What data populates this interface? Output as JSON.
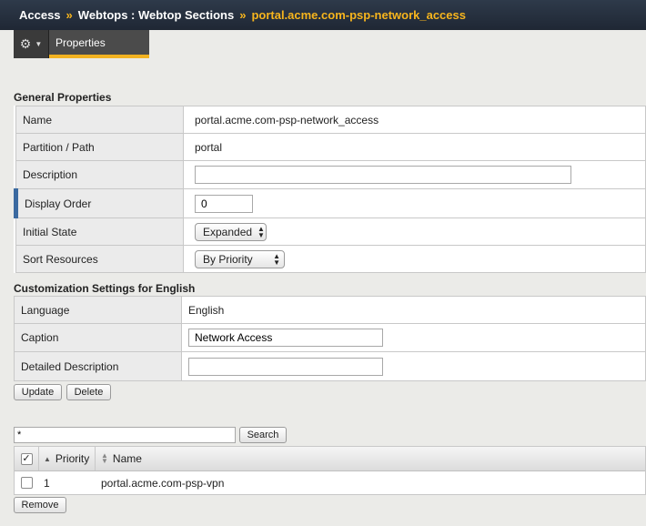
{
  "breadcrumb": {
    "root": "Access",
    "section": "Webtops : Webtop Sections",
    "current": "portal.acme.com-psp-network_access",
    "separator": "»"
  },
  "toolbar": {
    "gear_icon": "gear-icon",
    "tab_properties": "Properties"
  },
  "general": {
    "title": "General Properties",
    "name_label": "Name",
    "name_value": "portal.acme.com-psp-network_access",
    "partition_label": "Partition / Path",
    "partition_value": "portal",
    "description_label": "Description",
    "description_value": "",
    "display_order_label": "Display Order",
    "display_order_value": "0",
    "initial_state_label": "Initial State",
    "initial_state_value": "Expanded",
    "sort_resources_label": "Sort Resources",
    "sort_resources_value": "By Priority"
  },
  "customization": {
    "title": "Customization Settings for English",
    "language_label": "Language",
    "language_value": "English",
    "caption_label": "Caption",
    "caption_value": "Network Access",
    "detailed_label": "Detailed Description",
    "detailed_value": ""
  },
  "actions": {
    "update": "Update",
    "delete": "Delete"
  },
  "resources": {
    "filter_value": "*",
    "search": "Search",
    "header_priority": "Priority",
    "header_name": "Name",
    "rows": [
      {
        "priority": "1",
        "name": "portal.acme.com-psp-vpn"
      }
    ],
    "remove": "Remove"
  }
}
